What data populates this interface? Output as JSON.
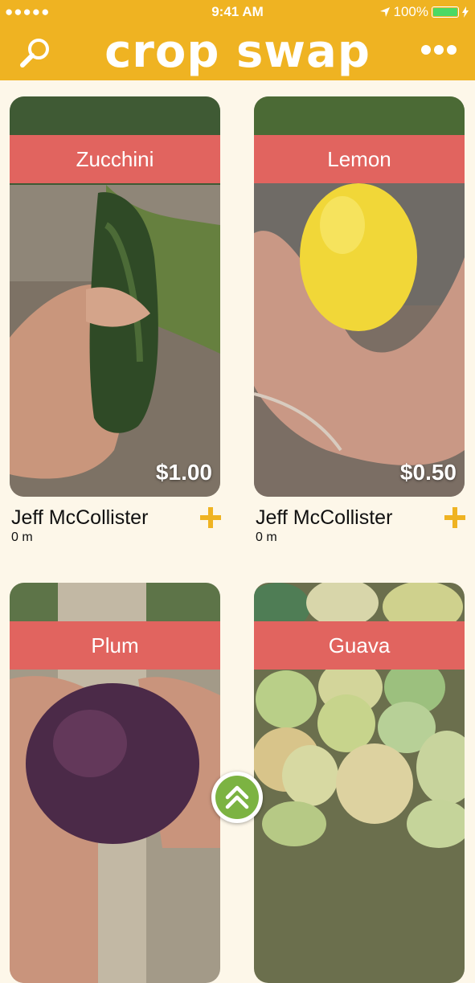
{
  "status": {
    "signal": "●●●●●",
    "time": "9:41 AM",
    "battery": "100%"
  },
  "header": {
    "logo": "crop swap",
    "search_icon": "search-icon",
    "more_icon": "more-icon"
  },
  "listings": [
    {
      "name": "Zucchini",
      "price": "$1.00",
      "owner": "Jeff McCollister",
      "distance": "0 m"
    },
    {
      "name": "Lemon",
      "price": "$0.50",
      "owner": "Jeff McCollister",
      "distance": "0 m"
    },
    {
      "name": "Plum"
    },
    {
      "name": "Guava"
    }
  ],
  "colors": {
    "brand": "#efb322",
    "banner": "#e1645f",
    "background": "#fdf7e9",
    "fab": "#7cb342"
  },
  "fab_icon": "scroll-to-top-icon"
}
